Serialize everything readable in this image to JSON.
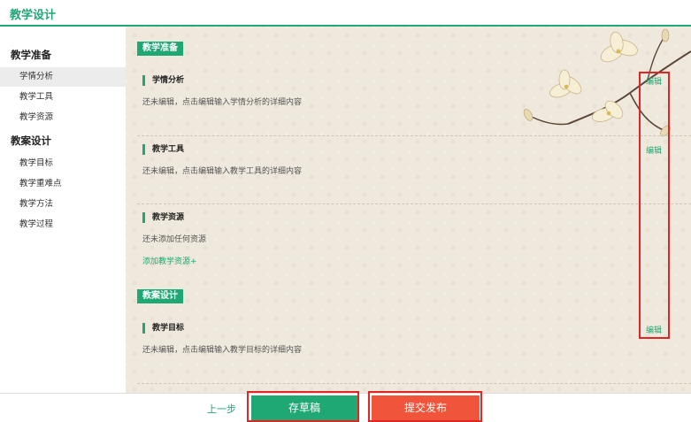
{
  "header": {
    "title": "教学设计"
  },
  "sidebar": {
    "groups": [
      {
        "title": "教学准备",
        "items": [
          "学情分析",
          "教学工具",
          "教学资源"
        ]
      },
      {
        "title": "教案设计",
        "items": [
          "教学目标",
          "教学重难点",
          "教学方法",
          "教学过程"
        ]
      }
    ],
    "active_item": "学情分析"
  },
  "main": {
    "group1_tag": "教学准备",
    "group2_tag": "教案设计",
    "sections": [
      {
        "title": "学情分析",
        "desc": "还未编辑，点击编辑输入学情分析的详细内容",
        "edit": "编辑"
      },
      {
        "title": "教学工具",
        "desc": "还未编辑，点击编辑输入教学工具的详细内容",
        "edit": "编辑"
      },
      {
        "title": "教学资源",
        "desc": "还未添加任何资源",
        "add_link": "添加教学资源+"
      },
      {
        "title": "教学目标",
        "desc": "还未编辑，点击编辑输入教学目标的详细内容",
        "edit": "编辑"
      }
    ]
  },
  "footer": {
    "prev": "上一步",
    "save": "存草稿",
    "submit": "提交发布"
  },
  "colors": {
    "accent": "#1fa774",
    "submit": "#f0553b",
    "highlight": "#e02525"
  }
}
